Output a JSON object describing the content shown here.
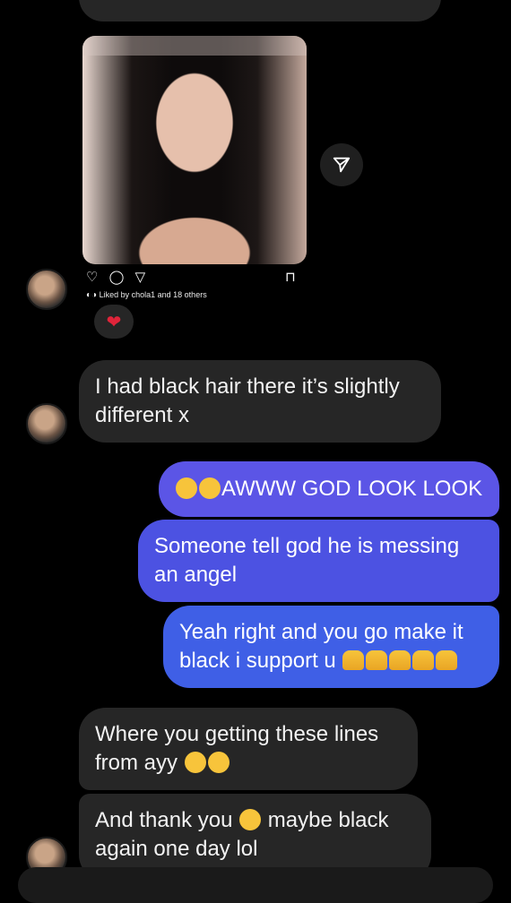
{
  "post": {
    "liked_by": "Liked by chola1 and 18 others"
  },
  "reaction": {
    "emoji": "heart"
  },
  "messages": [
    {
      "id": "m1",
      "direction": "received",
      "text": "I had black hair there it’s slightly",
      "text2": "different x"
    },
    {
      "id": "m2",
      "direction": "sent",
      "text": "AWWW GOD LOOK LOOK"
    },
    {
      "id": "m3",
      "direction": "sent",
      "text": "Someone tell god he is messing",
      "text2": "an angel"
    },
    {
      "id": "m4",
      "direction": "sent",
      "text": "Yeah right and you go make it",
      "text2": "black i support u"
    },
    {
      "id": "m5",
      "direction": "received",
      "text": "Where you getting these lines",
      "text2": "from ayy"
    },
    {
      "id": "m6",
      "direction": "received",
      "text": "And thank you",
      "text_after": "maybe black",
      "text2": "again one day lol"
    }
  ],
  "colors": {
    "sent_top": "#5b55e6",
    "sent_mid": "#4a52e0",
    "sent_bottom": "#3f5fe6",
    "received": "#262626",
    "background": "#000000"
  }
}
